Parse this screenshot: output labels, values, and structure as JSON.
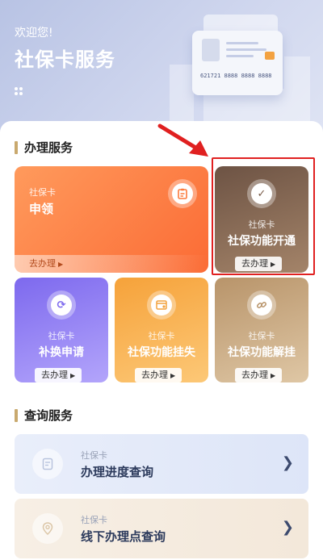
{
  "header": {
    "welcome": "欢迎您!",
    "title": "社保卡服务",
    "card_number": "621721 8888 8888 8888"
  },
  "sections": {
    "handle": "办理服务",
    "query": "查询服务"
  },
  "services": [
    {
      "sub": "社保卡",
      "name": "申领",
      "action": "去办理",
      "icon": "clipboard-icon"
    },
    {
      "sub": "社保卡",
      "name": "社保功能开通",
      "action": "去办理",
      "icon": "checkmark-icon"
    },
    {
      "sub": "社保卡",
      "name": "补换申请",
      "action": "去办理",
      "icon": "refresh-icon"
    },
    {
      "sub": "社保卡",
      "name": "社保功能挂失",
      "action": "去办理",
      "icon": "card-lock-icon"
    },
    {
      "sub": "社保卡",
      "name": "社保功能解挂",
      "action": "去办理",
      "icon": "unlink-icon"
    }
  ],
  "queries": [
    {
      "sub": "社保卡",
      "name": "办理进度查询",
      "icon": "document-icon"
    },
    {
      "sub": "社保卡",
      "name": "线下办理点查询",
      "icon": "location-pin-icon"
    }
  ],
  "colors": {
    "accent_bar": "#c9a96e",
    "highlight": "#e02020",
    "apply": "#fb7a3c",
    "activate": "#8d6b52",
    "replace": "#8a78f2",
    "report_loss": "#f7b04a",
    "unlock": "#c9a87c"
  }
}
